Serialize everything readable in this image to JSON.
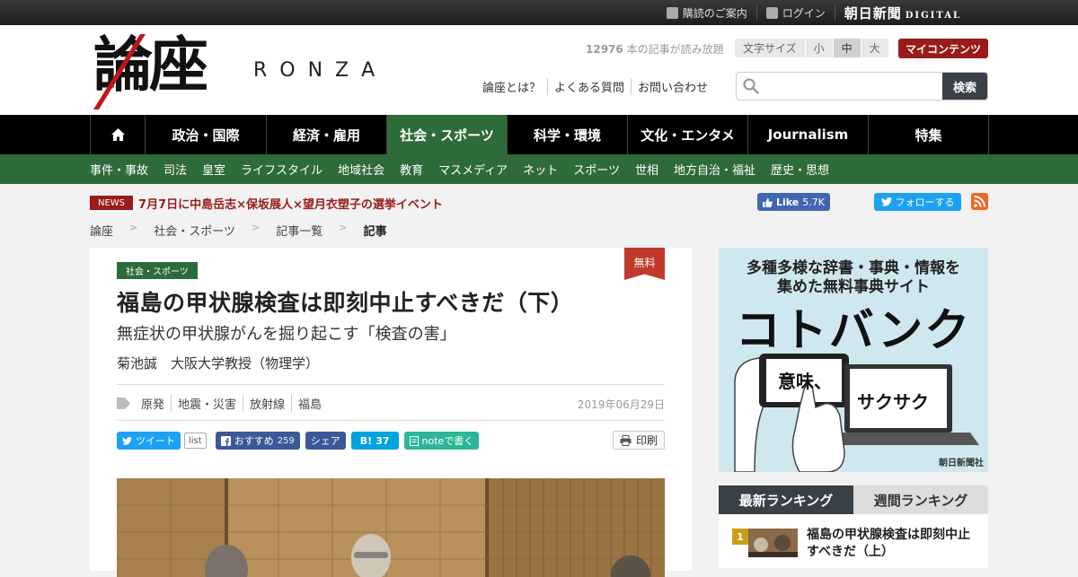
{
  "topbar": {
    "subscribe_label": "購読のご案内",
    "login_label": "ログイン",
    "brand": "朝日新聞",
    "brand_sub": "DIGITAL"
  },
  "header": {
    "logo_kanji": "論座",
    "logo_roman": "RONZA",
    "read_count": "12976",
    "read_count_suffix": "本の記事が読み放題",
    "font_size_label": "文字サイズ",
    "font_sizes": [
      "小",
      "中",
      "大"
    ],
    "font_size_selected": "中",
    "my_contents": "マイコンテンツ",
    "links": [
      "論座とは？",
      "よくある質問",
      "お問い合わせ"
    ],
    "search_placeholder": "",
    "search_button": "検索"
  },
  "main_nav": {
    "items": [
      "home-icon",
      "政治・国際",
      "経済・雇用",
      "社会・スポーツ",
      "科学・環境",
      "文化・エンタメ",
      "Journalism",
      "特集"
    ],
    "active": "社会・スポーツ"
  },
  "sub_nav": {
    "items": [
      "事件・事故",
      "司法",
      "皇室",
      "ライフスタイル",
      "地域社会",
      "教育",
      "マスメディア",
      "ネット",
      "スポーツ",
      "世相",
      "地方自治・福祉",
      "歴史・思想"
    ]
  },
  "news": {
    "tag": "NEWS",
    "text": "7月7日に中島岳志×保坂展人×望月衣塑子の選挙イベント"
  },
  "social": {
    "fb_like": "Like",
    "fb_count": "5.7K",
    "tw_follow": "フォローする"
  },
  "breadcrumb": [
    "論座",
    "社会・スポーツ",
    "記事一覧",
    "記事"
  ],
  "breadcrumb_sep": ">",
  "article": {
    "category": "社会・スポーツ",
    "free_badge": "無料",
    "title": "福島の甲状腺検査は即刻中止すべきだ（下）",
    "subtitle": "無症状の甲状腺がんを掘り起こす「検査の害」",
    "author": "菊池誠　大阪大学教授（物理学）",
    "tags": [
      "原発",
      "地震・災害",
      "放射線",
      "福島"
    ],
    "date": "2019年06月29日",
    "share": {
      "tweet": "ツイート",
      "list": "list",
      "fb_recommend": "おすすめ",
      "fb_count": "259",
      "fb_share": "シェア",
      "hatena_mark": "B!",
      "hatena_count": "37",
      "note": "noteで書く",
      "print": "印刷"
    }
  },
  "sidebar_ad": {
    "line1": "多種多様な辞書・事典・情報を",
    "line2": "集めた無料事典サイト",
    "title": "コトバンク",
    "bubble1": "意味、",
    "bubble2": "サクサク",
    "source": "朝日新聞社"
  },
  "ranking": {
    "tabs": [
      "最新ランキング",
      "週間ランキング"
    ],
    "active_tab": "最新ランキング",
    "items": [
      {
        "rank": "1",
        "title": "福島の甲状腺検査は即刻中止すべきだ（上）"
      }
    ]
  },
  "colors": {
    "nav_active": "#2e6b3a",
    "brand_red": "#9a1b1b",
    "free_red": "#c0392b"
  }
}
